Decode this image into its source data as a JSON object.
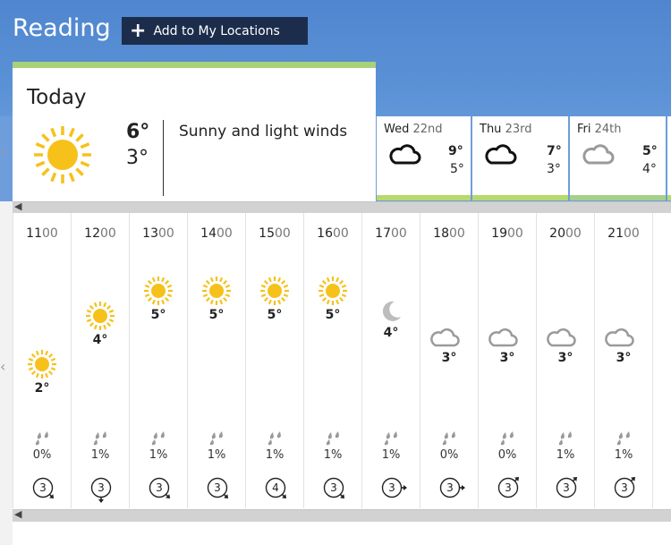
{
  "location": {
    "name": "Reading",
    "add_button_label": "Add to My Locations",
    "add_button_icon": "plus-icon"
  },
  "today": {
    "label": "Today",
    "icon": "sun-icon",
    "high": "6°",
    "low": "3°",
    "summary": "Sunny and light winds"
  },
  "days": [
    {
      "day": "Wed",
      "date": "22nd",
      "icon": "cloud-outline-icon",
      "high": "9°",
      "low": "5°"
    },
    {
      "day": "Thu",
      "date": "23rd",
      "icon": "cloud-outline-icon",
      "high": "7°",
      "low": "3°"
    },
    {
      "day": "Fri",
      "date": "24th",
      "icon": "cloud-light-icon",
      "high": "5°",
      "low": "4°"
    }
  ],
  "hours": [
    {
      "hh": "11",
      "mm": "00",
      "icon": "sun-icon",
      "temp": "2°",
      "rain": "0%",
      "wind": "3",
      "wind_dir": "down-right"
    },
    {
      "hh": "12",
      "mm": "00",
      "icon": "sun-icon",
      "temp": "4°",
      "rain": "1%",
      "wind": "3",
      "wind_dir": "down"
    },
    {
      "hh": "13",
      "mm": "00",
      "icon": "sun-icon",
      "temp": "5°",
      "rain": "1%",
      "wind": "3",
      "wind_dir": "down-right"
    },
    {
      "hh": "14",
      "mm": "00",
      "icon": "sun-icon",
      "temp": "5°",
      "rain": "1%",
      "wind": "3",
      "wind_dir": "down-right"
    },
    {
      "hh": "15",
      "mm": "00",
      "icon": "sun-icon",
      "temp": "5°",
      "rain": "1%",
      "wind": "4",
      "wind_dir": "down-right"
    },
    {
      "hh": "16",
      "mm": "00",
      "icon": "sun-icon",
      "temp": "5°",
      "rain": "1%",
      "wind": "3",
      "wind_dir": "down-right"
    },
    {
      "hh": "17",
      "mm": "00",
      "icon": "moon-icon",
      "temp": "4°",
      "rain": "1%",
      "wind": "3",
      "wind_dir": "right"
    },
    {
      "hh": "18",
      "mm": "00",
      "icon": "cloud-moon-icon",
      "temp": "3°",
      "rain": "0%",
      "wind": "3",
      "wind_dir": "right"
    },
    {
      "hh": "19",
      "mm": "00",
      "icon": "cloud-moon-icon",
      "temp": "3°",
      "rain": "0%",
      "wind": "3",
      "wind_dir": "up-right"
    },
    {
      "hh": "20",
      "mm": "00",
      "icon": "cloud-moon-icon",
      "temp": "3°",
      "rain": "1%",
      "wind": "3",
      "wind_dir": "up-right"
    },
    {
      "hh": "21",
      "mm": "00",
      "icon": "cloud-moon-icon",
      "temp": "3°",
      "rain": "1%",
      "wind": "3",
      "wind_dir": "up-right"
    }
  ],
  "colors": {
    "sky": "#5b92d6",
    "button_bg": "#1c2d4c",
    "today_accent": "#a8d17a",
    "day_accent": "#b7d96d",
    "sun": "#f6c11b"
  }
}
